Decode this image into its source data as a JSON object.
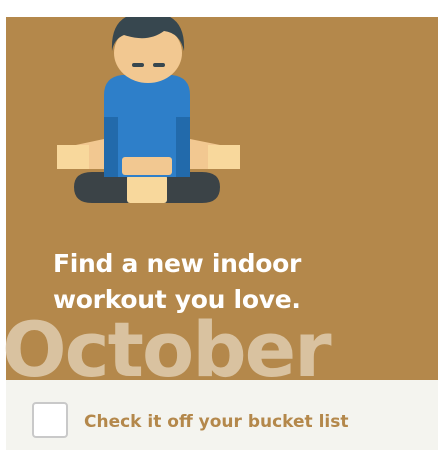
{
  "card": {
    "headline": "Find a new indoor workout you love.",
    "month": "October",
    "illustration_icon": "meditating-person-icon"
  },
  "footer": {
    "checkbox_checked": false,
    "checkbox_label": "Check it off your bucket list"
  },
  "colors": {
    "card_background": "#b4884b",
    "month_text": "#d9c2a0",
    "footer_background": "#f4f4ef",
    "label_text": "#b4884b",
    "shirt": "#2e7fc9",
    "hair": "#37474f",
    "skin": "#f2c891",
    "pants": "#3b4347"
  }
}
